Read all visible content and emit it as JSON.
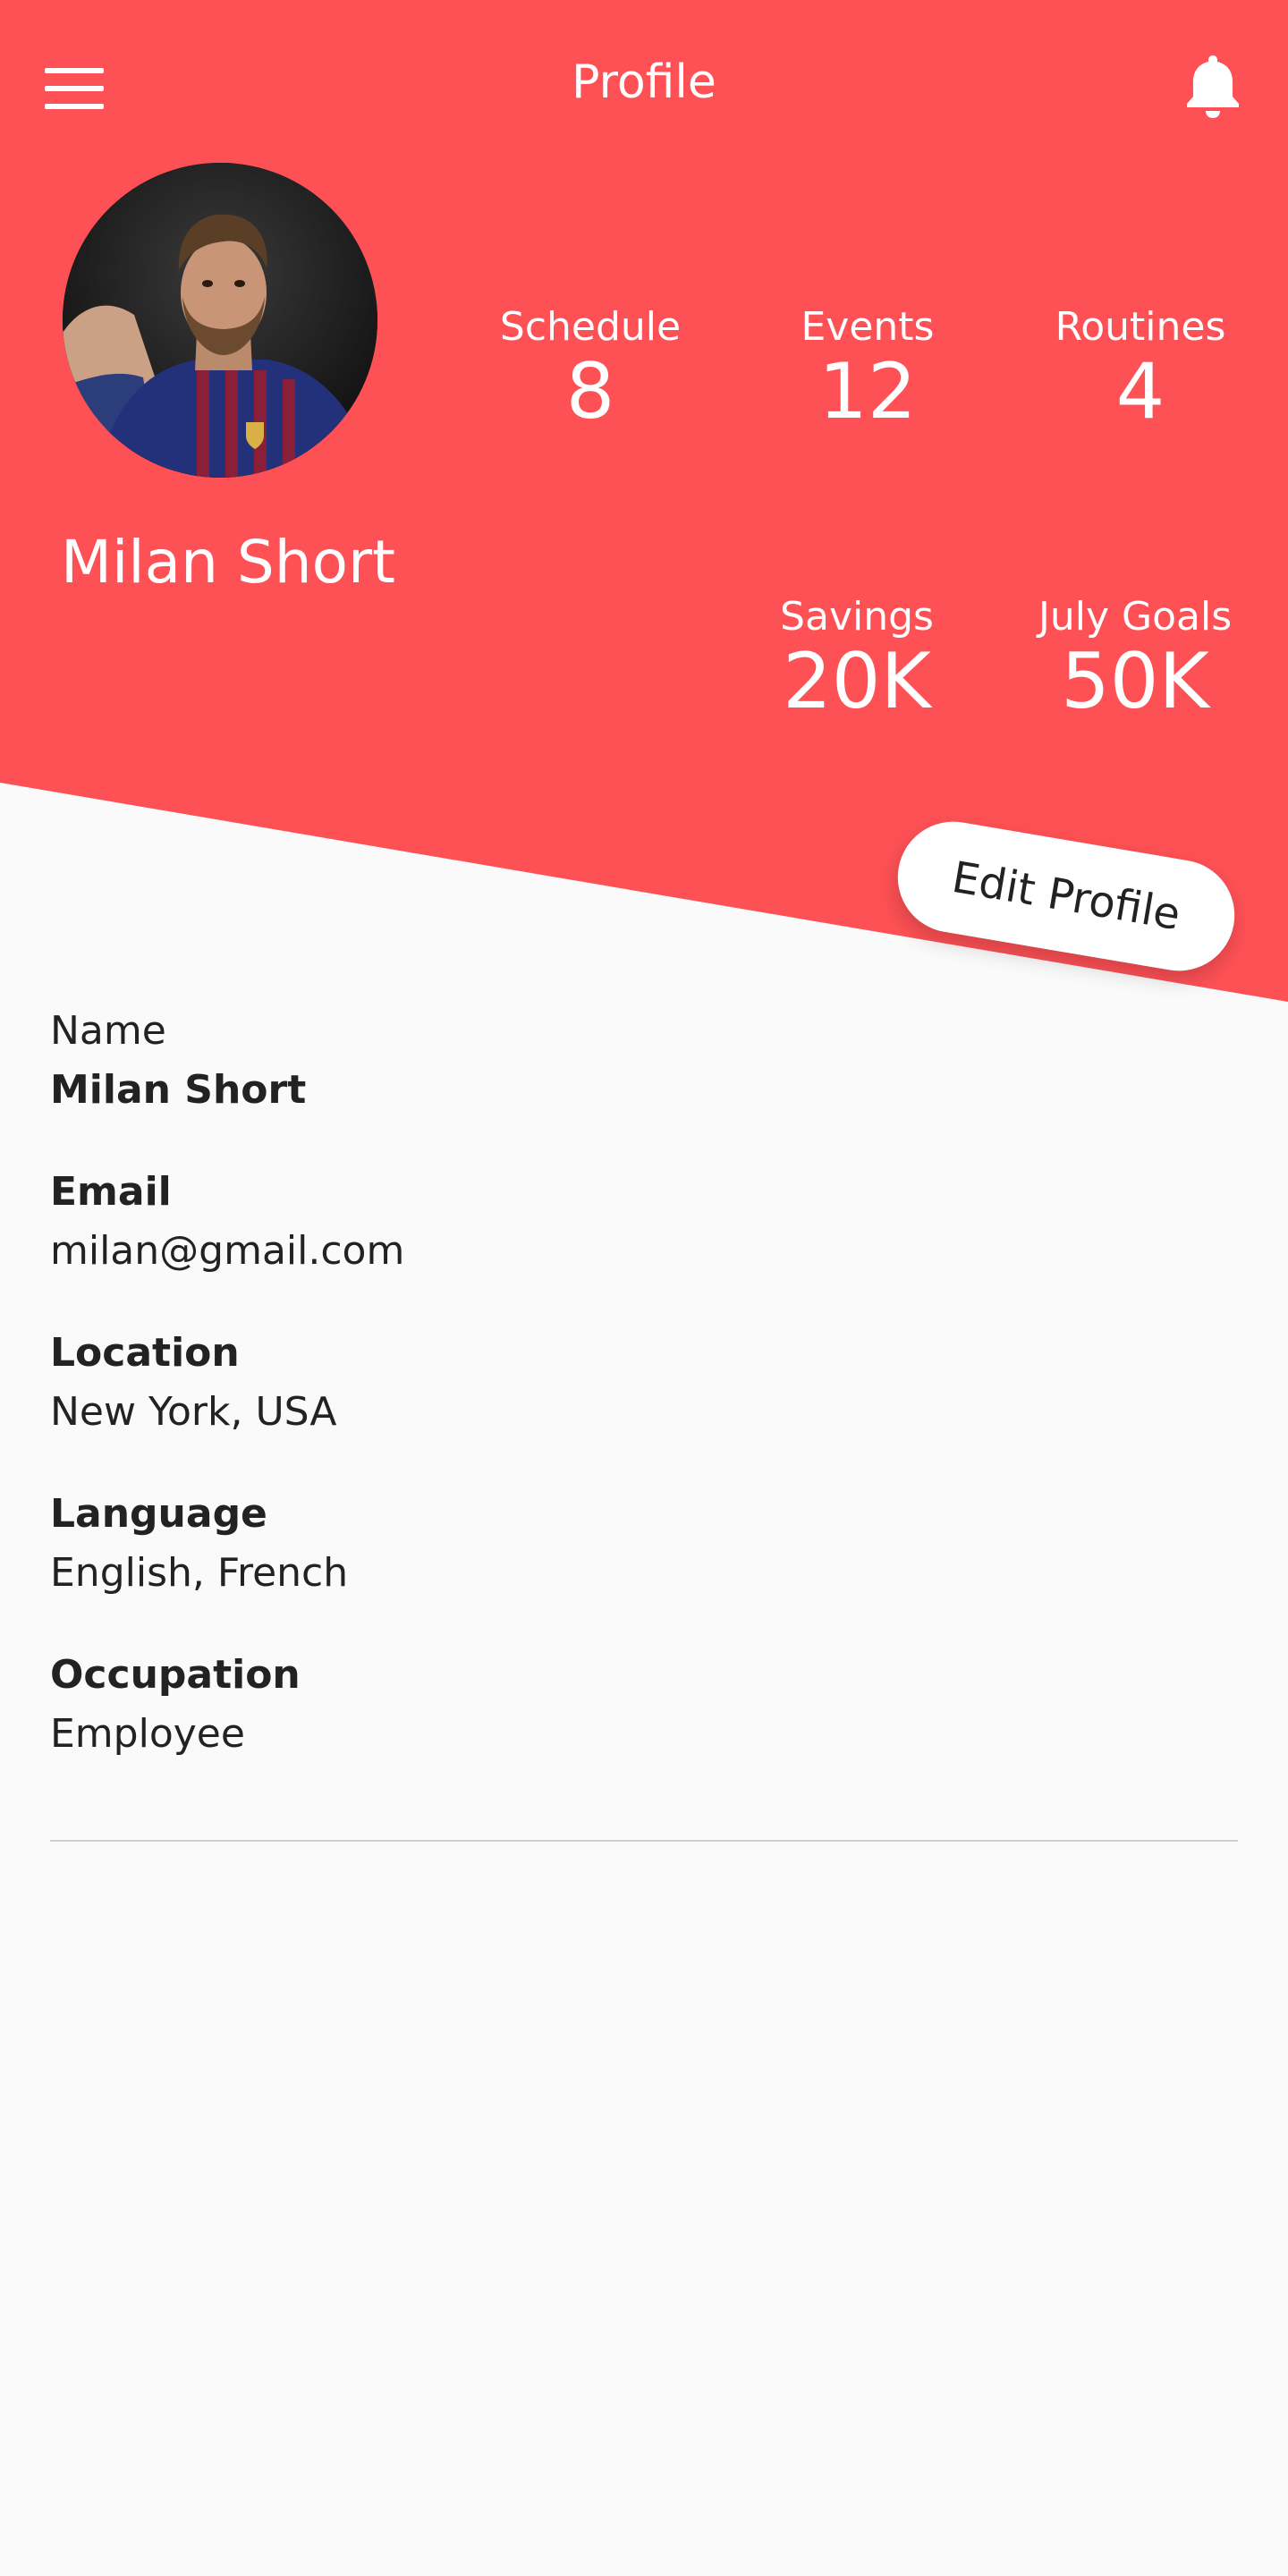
{
  "header": {
    "title": "Profile",
    "background_color": "#fe5155",
    "menu_icon": "hamburger-menu-icon",
    "notification_icon": "bell-icon"
  },
  "profile": {
    "name": "Milan Short",
    "avatar_alt": "profile photo"
  },
  "stats": [
    {
      "label": "Schedule",
      "value": "8"
    },
    {
      "label": "Events",
      "value": "12"
    },
    {
      "label": "Routines",
      "value": "4"
    },
    {
      "label": "Savings",
      "value": "20K"
    },
    {
      "label": "July Goals",
      "value": "50K"
    }
  ],
  "edit_button": {
    "label": "Edit Profile"
  },
  "details": [
    {
      "label": "Name",
      "value": "Milan Short"
    },
    {
      "label": "Email",
      "value": "milan@gmail.com"
    },
    {
      "label": "Location",
      "value": "New York, USA"
    },
    {
      "label": "Language",
      "value": "English, French"
    },
    {
      "label": "Occupation",
      "value": "Employee"
    }
  ]
}
